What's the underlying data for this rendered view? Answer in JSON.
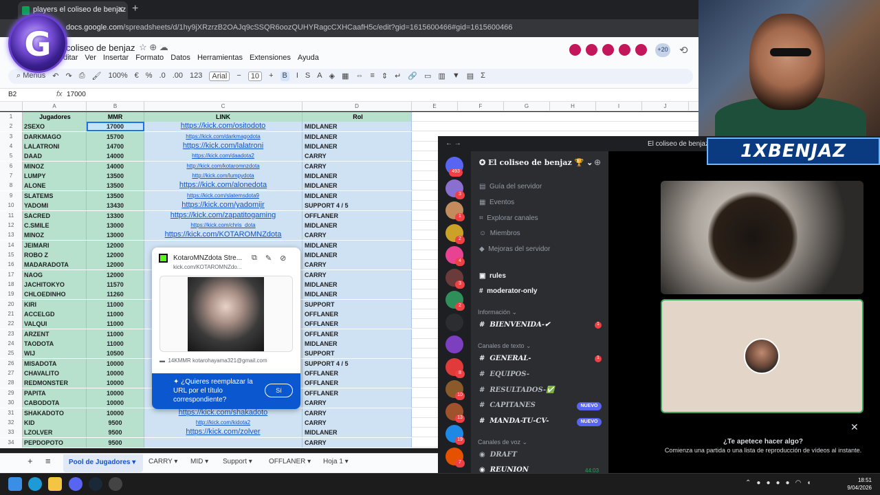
{
  "browser": {
    "tab_title": "players el coliseo de benjaz - Hoja",
    "url_host": "docs.google.com",
    "url_path": "/spreadsheets/d/1hy9jXRzrzB2OAJq9cSSQR6oozQUHYRagcCXHCaafH5c/edit?gid=1615600466#gid=1615600466",
    "logo_letter": "G"
  },
  "sheets": {
    "title": "coliseo de benjaz",
    "menu": [
      "ditar",
      "Ver",
      "Insertar",
      "Formato",
      "Datos",
      "Herramientas",
      "Extensiones",
      "Ayuda"
    ],
    "collaborators_extra": "+20",
    "toolbar": {
      "menus": "Menús",
      "zoom": "100%",
      "currency": "€",
      "percent": "%",
      "dec_less": ".0",
      "dec_more": ".00",
      "num_fmt": "123",
      "font": "Arial",
      "font_size": "10",
      "bold": "B",
      "italic": "I",
      "strike": "S",
      "underline_a": "A",
      "minus": "−",
      "plus": "+",
      "sigma": "Σ"
    },
    "name_box": "B2",
    "fx": "fx",
    "formula_value": "17000",
    "columns": [
      "A",
      "B",
      "C",
      "D",
      "E",
      "F",
      "G",
      "H",
      "I",
      "J"
    ],
    "headers": {
      "jugadores": "Jugadores",
      "mmr": "MMR",
      "link": "LINK",
      "rol": "Rol"
    },
    "rows": [
      {
        "n": "2",
        "player": "2SEXO",
        "mmr": "17000",
        "link": "https://kick.com/ositodoto",
        "rol": "MIDLANER",
        "big": true
      },
      {
        "n": "3",
        "player": "DARKMAGO",
        "mmr": "15700",
        "link": "https://kick.com/darkmagodota",
        "rol": "MIDLANER",
        "big": false
      },
      {
        "n": "4",
        "player": "LALATRONI",
        "mmr": "14700",
        "link": "https://kick.com/lalatroni",
        "rol": "MIDLANER",
        "big": true
      },
      {
        "n": "5",
        "player": "DAAD",
        "mmr": "14000",
        "link": "https://kick.com/daadota2",
        "rol": "CARRY",
        "big": false
      },
      {
        "n": "6",
        "player": "MINOZ",
        "mmr": "14000",
        "link": "http://kick.com/kotaromnzdota",
        "rol": "CARRY",
        "big": false
      },
      {
        "n": "7",
        "player": "LUMPY",
        "mmr": "13500",
        "link": "http://kick.com/lumpydota",
        "rol": "MIDLANER",
        "big": false
      },
      {
        "n": "8",
        "player": "ALONE",
        "mmr": "13500",
        "link": "https://kick.com/alonedota",
        "rol": "MIDLANER",
        "big": true
      },
      {
        "n": "9",
        "player": "SLATEMS",
        "mmr": "13500",
        "link": "https://kick.com/slatemsdota9",
        "rol": "MIDLANER",
        "big": false
      },
      {
        "n": "10",
        "player": "YADOMI",
        "mmr": "13430",
        "link": "https://kick.com/yadomijr",
        "rol": "SUPPORT 4 / 5",
        "big": true
      },
      {
        "n": "11",
        "player": "SACRED",
        "mmr": "13300",
        "link": "https://kick.com/zapatitogaming",
        "rol": "OFFLANER",
        "big": true
      },
      {
        "n": "12",
        "player": "C.SMILE",
        "mmr": "13000",
        "link": "https://kick.com/chris_dota",
        "rol": "MIDLANER",
        "big": false
      },
      {
        "n": "13",
        "player": "MINOZ",
        "mmr": "13000",
        "link": "https://kick.com/KOTAROMNZdota",
        "rol": "CARRY",
        "big": true
      },
      {
        "n": "14",
        "player": "JEIMARI",
        "mmr": "12000",
        "link": "",
        "rol": "MIDLANER",
        "big": false
      },
      {
        "n": "15",
        "player": "ROBO Z",
        "mmr": "12000",
        "link": "",
        "rol": "MIDLANER",
        "big": false
      },
      {
        "n": "16",
        "player": "MADARADOTA",
        "mmr": "12000",
        "link": "",
        "rol": "CARRY",
        "big": false
      },
      {
        "n": "17",
        "player": "NAOG",
        "mmr": "12000",
        "link": "",
        "rol": "CARRY",
        "big": false
      },
      {
        "n": "18",
        "player": "JACHITOKYO",
        "mmr": "11570",
        "link": "",
        "rol": "MIDLANER",
        "big": false
      },
      {
        "n": "19",
        "player": "CHLOEDINHO",
        "mmr": "11260",
        "link": "",
        "rol": "MIDLANER",
        "big": false
      },
      {
        "n": "20",
        "player": "KIRI",
        "mmr": "11000",
        "link": "",
        "rol": "SUPPORT",
        "big": false
      },
      {
        "n": "21",
        "player": "ACCELGD",
        "mmr": "11000",
        "link": "",
        "rol": "OFFLANER",
        "big": false
      },
      {
        "n": "22",
        "player": "VALQUI",
        "mmr": "11000",
        "link": "",
        "rol": "OFFLANER",
        "big": false
      },
      {
        "n": "23",
        "player": "ARZENT",
        "mmr": "11000",
        "link": "",
        "rol": "OFFLANER",
        "big": false
      },
      {
        "n": "24",
        "player": "TAODOTA",
        "mmr": "11000",
        "link": "",
        "rol": "MIDLANER",
        "big": false
      },
      {
        "n": "25",
        "player": "WIJ",
        "mmr": "10500",
        "link": "",
        "rol": "SUPPORT",
        "big": false
      },
      {
        "n": "26",
        "player": "MISADOTA",
        "mmr": "10000",
        "link": "",
        "rol": "SUPPORT 4 / 5",
        "big": false
      },
      {
        "n": "27",
        "player": "CHAVALITO",
        "mmr": "10000",
        "link": "",
        "rol": "OFFLANER",
        "big": false
      },
      {
        "n": "28",
        "player": "REDMONSTER",
        "mmr": "10000",
        "link": "",
        "rol": "OFFLANER",
        "big": false
      },
      {
        "n": "29",
        "player": "PAPITA",
        "mmr": "10000",
        "link": "",
        "rol": "OFFLANER",
        "big": false
      },
      {
        "n": "30",
        "player": "CABODOTA",
        "mmr": "10000",
        "link": "",
        "rol": "CARRY",
        "big": false
      },
      {
        "n": "31",
        "player": "SHAKADOTO",
        "mmr": "10000",
        "link": "https://kick.com/shakadoto",
        "rol": "CARRY",
        "big": true
      },
      {
        "n": "32",
        "player": "KID",
        "mmr": "9500",
        "link": "http://kick.com/kidota2",
        "rol": "CARRY",
        "big": false
      },
      {
        "n": "33",
        "player": "LZOLVER",
        "mmr": "9500",
        "link": "https://kick.com/zolver",
        "rol": "MIDLANER",
        "big": true
      },
      {
        "n": "34",
        "player": "PEPDOPOTO",
        "mmr": "9500",
        "link": "",
        "rol": "CARRY",
        "big": false
      }
    ],
    "popup": {
      "title": "KotaroMNZdota Stre...",
      "url": "kick.com/KOTAROMNZdo...",
      "description": "14KMMR kotarohayama321@gmail.com",
      "question": "¿Quieres reemplazar la URL por el título correspondiente?",
      "yes": "Sí"
    },
    "tabs": [
      "Pool de Jugadores",
      "CARRY",
      "MID",
      "Support",
      "OFFLANER",
      "Hoja 1"
    ]
  },
  "overlay": {
    "banner": "1XBENJAZ"
  },
  "discord": {
    "window_title": "El coliseo de benjaz",
    "server_name": "El coliseo de benjaz 🏆",
    "server_badges": [
      "493",
      "3",
      "1",
      "2",
      "4",
      "3",
      "2",
      "",
      "",
      "8",
      "10",
      "13",
      "19",
      "7"
    ],
    "nav": [
      "Guía del servidor",
      "Eventos",
      "Explorar canales",
      "Miembros",
      "Mejoras del servidor"
    ],
    "top_channels": [
      "rules",
      "moderator-only"
    ],
    "cat_info": "Información",
    "bienvenida": "BIENVENIDA-✔",
    "cat_text": "Canales de texto",
    "text_channels": [
      "GENERAL-",
      "EQUIPOS-",
      "RESULTADOS-✅",
      "CAPITANES",
      "MANDA-TU-CV-"
    ],
    "nuevo": "NUEVO",
    "unread_1": "1",
    "cat_voice": "Canales de voz",
    "voice_channels": [
      "DRAFT",
      "REUNION"
    ],
    "voice_time": "44:03",
    "activity_q": "¿Te apetece hacer algo?",
    "activity_sub": "Comienza una partida o una lista de reproducción de vídeos al instante."
  },
  "taskbar": {
    "time": "18:51",
    "date": "9/04/2026"
  },
  "colors": {
    "green": "#b7e1cd",
    "blue": "#cfe2f3",
    "discord_bg": "#2b2d31",
    "accent": "#0b57d0"
  }
}
